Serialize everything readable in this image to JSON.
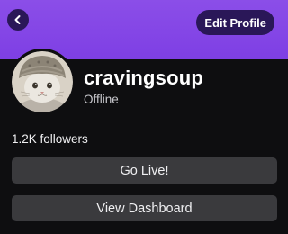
{
  "header": {
    "back_icon": "chevron-left-icon",
    "edit_profile_label": "Edit Profile",
    "banner_color": "#8b4ee8"
  },
  "profile": {
    "username": "cravingsoup",
    "status": "Offline",
    "followers": "1.2K followers",
    "avatar": "cat-wearing-knit-hat"
  },
  "actions": {
    "go_live_label": "Go Live!",
    "dashboard_label": "View Dashboard"
  }
}
